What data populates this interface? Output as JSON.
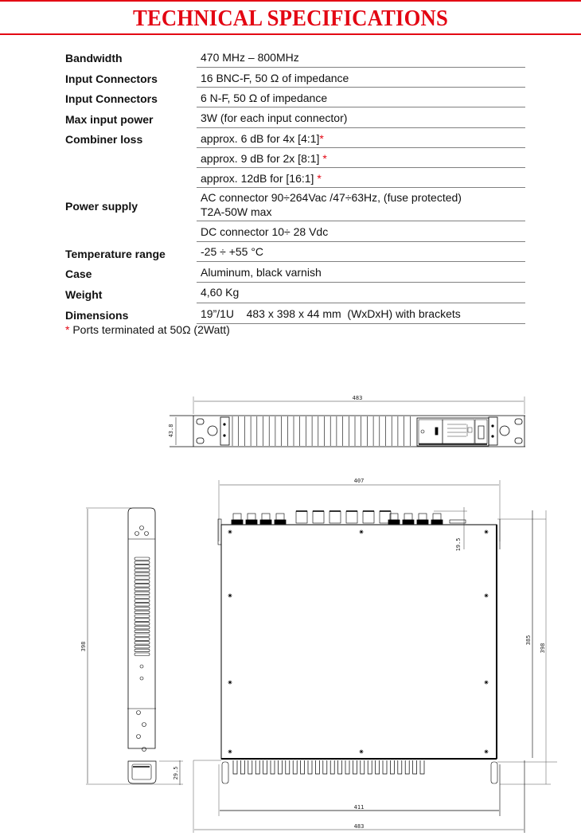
{
  "header": {
    "title": "TECHNICAL SPECIFICATIONS",
    "accent_color": "#e30613"
  },
  "specs": [
    {
      "label": "Bandwidth",
      "value": "470 MHz – 800MHz",
      "star": false
    },
    {
      "label": "Input Connectors",
      "value": "16 BNC-F, 50 Ω of impedance",
      "star": false
    },
    {
      "label": "Input Connectors",
      "value": "6 N-F, 50 Ω of impedance",
      "star": false
    },
    {
      "label": "Max input power",
      "value": "3W (for each input connector)",
      "star": false
    },
    {
      "label": "Combiner loss",
      "value": "approx. 6 dB for 4x [4:1]",
      "star": true
    },
    {
      "label": "",
      "value": "approx. 9 dB for 2x [8:1] ",
      "star": true
    },
    {
      "label": "",
      "value": "approx. 12dB for [16:1] ",
      "star": true
    },
    {
      "label": "Power supply",
      "value": "AC connector 90÷264Vac /47÷63Hz, (fuse protected)",
      "value2": "T2A-50W max",
      "star": false
    },
    {
      "label": "",
      "value": "DC connector 10÷ 28 Vdc",
      "star": false
    },
    {
      "label": "Temperature range",
      "value": "-25 ÷ +55 °C",
      "star": false
    },
    {
      "label": "Case",
      "value": "Aluminum, black varnish",
      "star": false
    },
    {
      "label": "Weight",
      "value": "4,60 Kg",
      "star": false
    },
    {
      "label": "Dimensions",
      "value": "19”/1U    483 x 398 x 44 mm  (WxDxH) with brackets",
      "star": false
    }
  ],
  "footnote": {
    "star": "*",
    "text": " Ports terminated at 50Ω (2Watt)"
  },
  "drawings": {
    "front_view": {
      "width_dim": "483",
      "height_dim": "43.8"
    },
    "top_view": {
      "depth_dim": "407",
      "connector_dim": "19.5",
      "inner_dim": "385",
      "total_depth": "398",
      "base_width": "411",
      "total_width": "483"
    },
    "side_view": {
      "depth_dim": "398",
      "handle_dim": "29.5"
    }
  }
}
